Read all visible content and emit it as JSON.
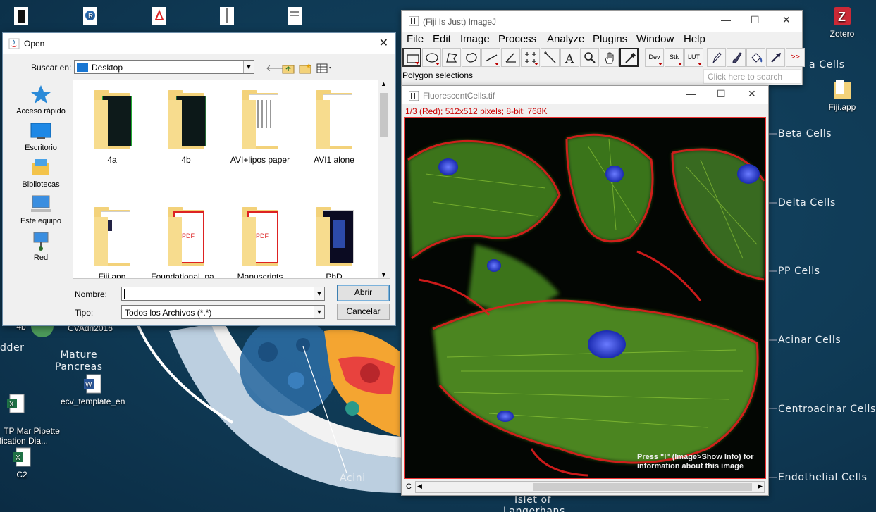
{
  "desktop": {
    "icons": [
      {
        "label": ""
      },
      {
        "label": ""
      },
      {
        "label": ""
      },
      {
        "label": ""
      },
      {
        "label": ""
      },
      {
        "label": "Zotero"
      },
      {
        "label": "Fiji.app"
      },
      {
        "label": "4b"
      },
      {
        "label": "CVAdri2016"
      },
      {
        "label": "TP Mar Pipette\nrification Dia..."
      },
      {
        "label": "ecv_template_en"
      },
      {
        "label": "C2"
      }
    ],
    "wallpaper_labels": {
      "alpha_cells": "a Cells",
      "beta_cells": "Beta Cells",
      "delta_cells": "Delta Cells",
      "pp_cells": "PP Cells",
      "acinar_cells": "Acinar Cells",
      "centroacinar_cells": "Centroacinar Cells",
      "endothelial_cells": "Endothelial Cells",
      "mature_pancreas": "Mature\nPancreas",
      "acini": "Acini",
      "islet_of": "Islet of",
      "langerhans": "Langerhans",
      "bladder": "dder"
    }
  },
  "open_dialog": {
    "title": "Open",
    "look_in_label": "Buscar en:",
    "look_in_value": "Desktop",
    "places": [
      {
        "label": "Acceso rápido",
        "icon": "star-icon"
      },
      {
        "label": "Escritorio",
        "icon": "desktop-icon"
      },
      {
        "label": "Bibliotecas",
        "icon": "libraries-icon"
      },
      {
        "label": "Este equipo",
        "icon": "computer-icon"
      },
      {
        "label": "Red",
        "icon": "network-icon"
      }
    ],
    "files": [
      {
        "name": "4a"
      },
      {
        "name": "4b"
      },
      {
        "name": "AVI+lipos paper"
      },
      {
        "name": "AVI1 alone"
      },
      {
        "name": "Fiji.app"
      },
      {
        "name": "Foundational_pa..."
      },
      {
        "name": "Manuscripts"
      },
      {
        "name": "PhD"
      }
    ],
    "filename_label": "Nombre:",
    "filename_value": "",
    "filetype_label": "Tipo:",
    "filetype_value": "Todos los Archivos (*.*)",
    "open_button": "Abrir",
    "cancel_button": "Cancelar"
  },
  "imagej": {
    "title": "(Fiji Is Just) ImageJ",
    "menu": [
      "File",
      "Edit",
      "Image",
      "Process",
      "Analyze",
      "Plugins",
      "Window",
      "Help"
    ],
    "tool_labels": {
      "dev": "Dev",
      "stk": "Stk",
      "lut": "LUT",
      "more": ">>"
    },
    "status": "Polygon selections",
    "search_placeholder": "Click here to search"
  },
  "image_window": {
    "title": "FluorescentCells.tif",
    "info": "1/3 (Red); 512x512 pixels; 8-bit; 768K",
    "hint_line1": "Press \"I\" (Image>Show Info) for",
    "hint_line2": "information about this image",
    "channel_label": "C"
  },
  "colors": {
    "wallpaper": "#0f3a55",
    "info_red": "#cc0000",
    "dialog_bg": "#f0f0f0"
  }
}
